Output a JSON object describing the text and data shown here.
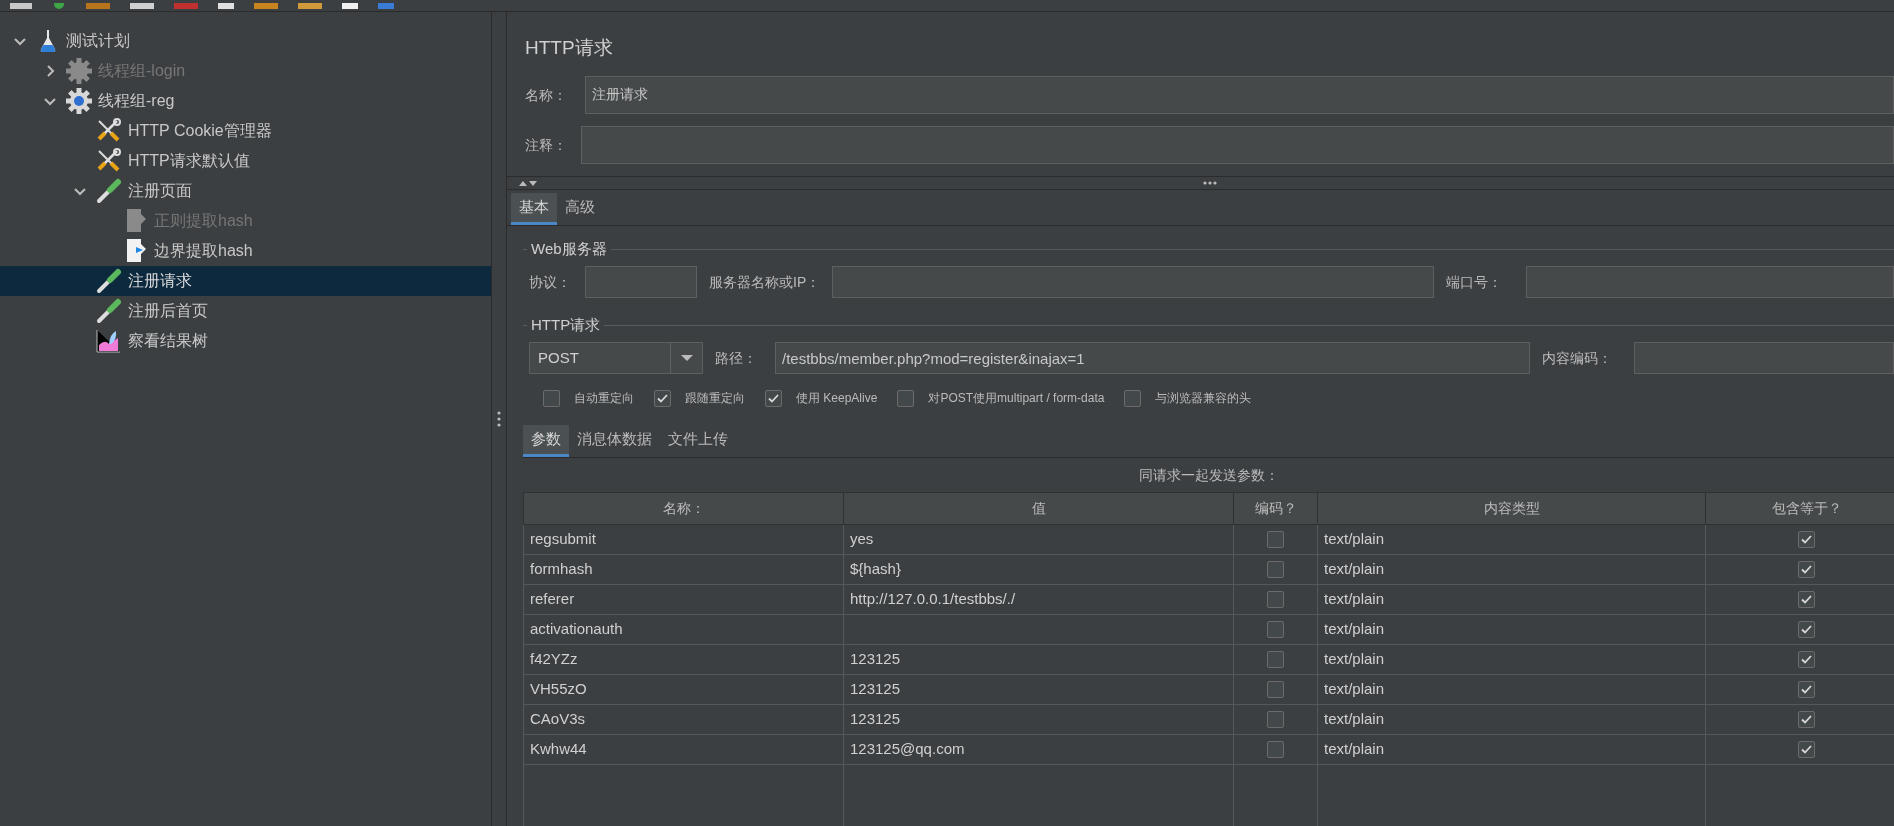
{
  "tree": [
    {
      "label": "测试计划",
      "kind": "plan",
      "expanded": true,
      "disabled": false,
      "selected": false,
      "children": [
        {
          "label": "线程组-login",
          "kind": "thread-group",
          "expanded": false,
          "disabled": true,
          "selected": false
        },
        {
          "label": "线程组-reg",
          "kind": "thread-group",
          "expanded": true,
          "disabled": false,
          "selected": false,
          "children": [
            {
              "label": "HTTP Cookie管理器",
              "kind": "config",
              "disabled": false,
              "selected": false
            },
            {
              "label": "HTTP请求默认值",
              "kind": "config",
              "disabled": false,
              "selected": false
            },
            {
              "label": "注册页面",
              "kind": "sampler",
              "expanded": true,
              "disabled": false,
              "selected": false,
              "children": [
                {
                  "label": "正则提取hash",
                  "kind": "extractor",
                  "disabled": true,
                  "selected": false
                },
                {
                  "label": "边界提取hash",
                  "kind": "extractor",
                  "disabled": false,
                  "selected": false
                }
              ]
            },
            {
              "label": "注册请求",
              "kind": "sampler",
              "disabled": false,
              "selected": true
            },
            {
              "label": "注册后首页",
              "kind": "sampler",
              "disabled": false,
              "selected": false
            },
            {
              "label": "察看结果树",
              "kind": "listener",
              "disabled": false,
              "selected": false
            }
          ]
        }
      ]
    }
  ],
  "editor": {
    "title": "HTTP请求",
    "name_label": "名称：",
    "name_value": "注册请求",
    "comment_label": "注释："
  },
  "tabs": [
    {
      "label": "基本",
      "selected": true
    },
    {
      "label": "高级",
      "selected": false
    }
  ],
  "web_server": {
    "legend": "Web服务器",
    "protocol_label": "协议：",
    "server_label": "服务器名称或IP：",
    "port_label": "端口号："
  },
  "http_request": {
    "legend": "HTTP请求",
    "method": "POST",
    "path_label": "路径：",
    "path": "/testbbs/member.php?mod=register&inajax=1",
    "encoding_label": "内容编码："
  },
  "options": [
    {
      "label": "自动重定向",
      "checked": false
    },
    {
      "label": "跟随重定向",
      "checked": true
    },
    {
      "label": "使用 KeepAlive",
      "checked": true
    },
    {
      "label": "对POST使用multipart / form-data",
      "checked": false
    },
    {
      "label": "与浏览器兼容的头",
      "checked": false
    }
  ],
  "param_tabs": [
    {
      "label": "参数",
      "selected": true
    },
    {
      "label": "消息体数据",
      "selected": false
    },
    {
      "label": "文件上传",
      "selected": false
    }
  ],
  "params": {
    "caption": "同请求一起发送参数：",
    "columns": [
      "名称：",
      "值",
      "编码？",
      "内容类型",
      "包含等于？"
    ],
    "rows": [
      {
        "name": "regsubmit",
        "value": "yes",
        "encode": false,
        "content_type": "text/plain",
        "include_equals": true
      },
      {
        "name": "formhash",
        "value": "${hash}",
        "encode": false,
        "content_type": "text/plain",
        "include_equals": true
      },
      {
        "name": "referer",
        "value": "http://127.0.0.1/testbbs/./",
        "encode": false,
        "content_type": "text/plain",
        "include_equals": true
      },
      {
        "name": "activationauth",
        "encode": false,
        "content_type": "text/plain",
        "include_equals": true
      },
      {
        "name": "f42YZz",
        "value": "123125",
        "encode": false,
        "content_type": "text/plain",
        "include_equals": true
      },
      {
        "name": "VH55zO",
        "value": "123125",
        "encode": false,
        "content_type": "text/plain",
        "include_equals": true
      },
      {
        "name": "CAoV3s",
        "value": "123125",
        "encode": false,
        "content_type": "text/plain",
        "include_equals": true
      },
      {
        "name": "Kwhw44",
        "value": "123125@qq.com",
        "encode": false,
        "content_type": "text/plain",
        "include_equals": true
      }
    ]
  }
}
